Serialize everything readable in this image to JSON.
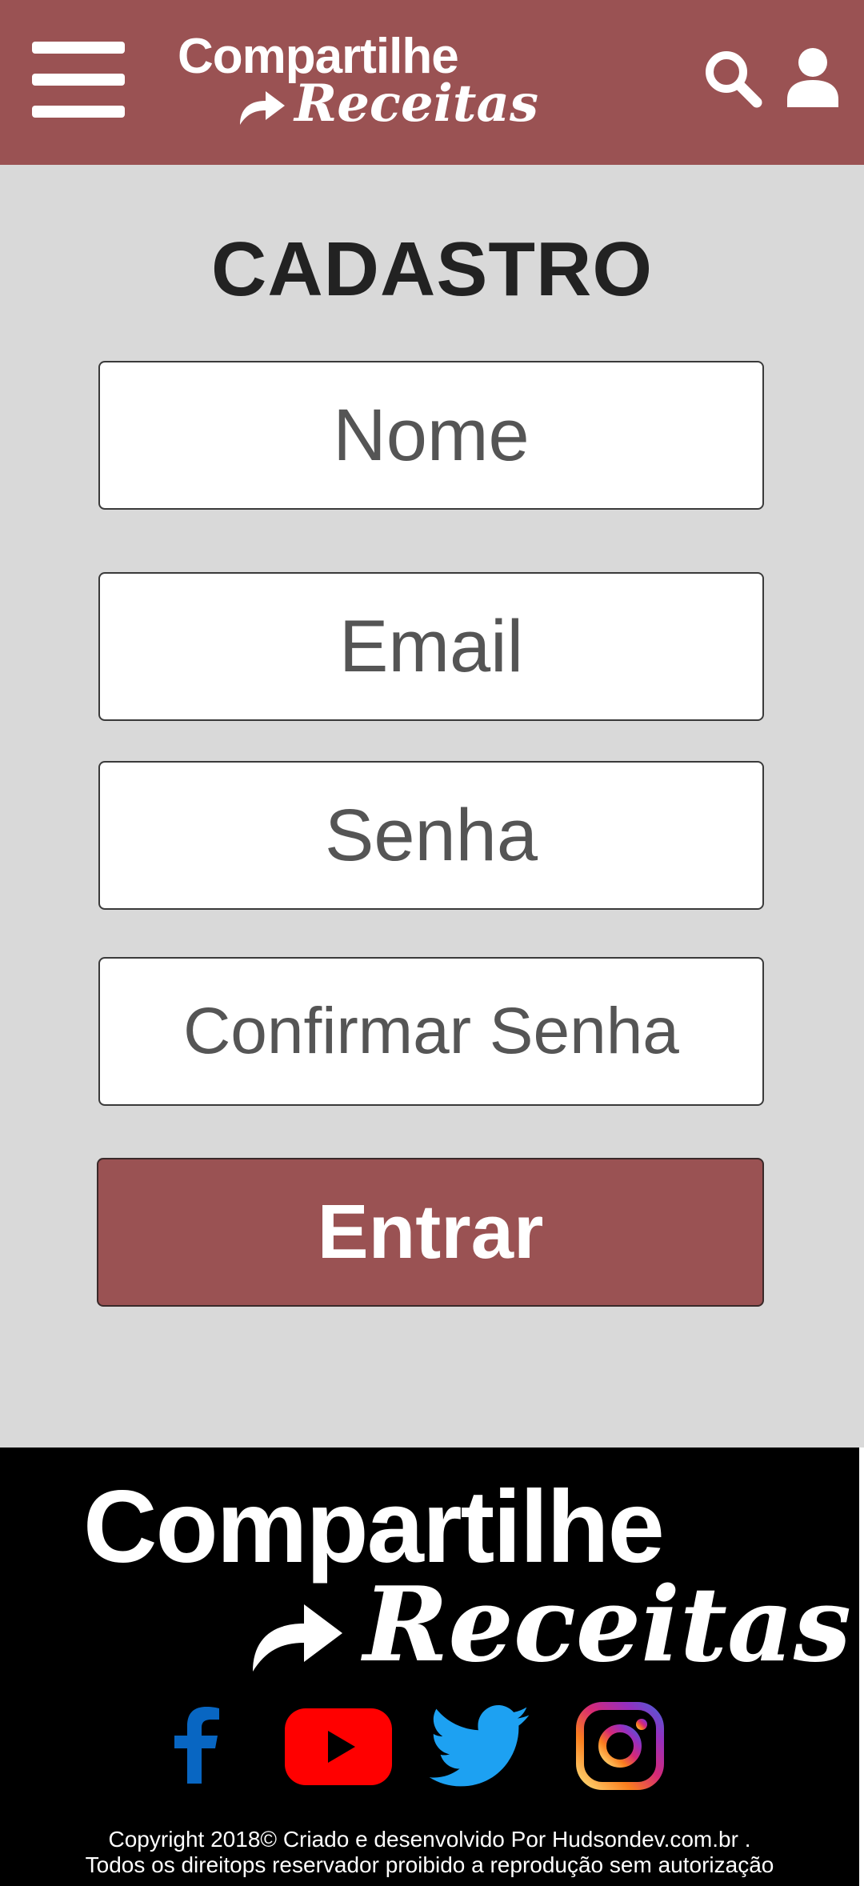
{
  "colors": {
    "brand": "#9a5253",
    "page_background": "#d9d9d9",
    "footer_background": "#000000",
    "facebook": "#0866c2",
    "youtube": "#ff0000",
    "twitter": "#1da1f2"
  },
  "header": {
    "menu_icon": "hamburger-menu-icon",
    "logo": {
      "line1": "Compartilhe",
      "line2": "Receitas",
      "arrow_icon": "share-arrow-icon"
    },
    "search_icon": "search-icon",
    "user_icon": "user-icon"
  },
  "main": {
    "title": "CADASTRO",
    "fields": {
      "nome_placeholder": "Nome",
      "email_placeholder": "Email",
      "senha_placeholder": "Senha",
      "confirmar_senha_placeholder": "Confirmar Senha"
    },
    "submit_label": "Entrar"
  },
  "footer": {
    "logo": {
      "line1": "Compartilhe",
      "line2": "Receitas",
      "arrow_icon": "share-arrow-icon"
    },
    "social": [
      "facebook-icon",
      "youtube-icon",
      "twitter-icon",
      "instagram-icon"
    ],
    "copyright_line1": "Copyright 2018© Criado e desenvolvido Por Hudsondev.com.br  .",
    "copyright_line2": "Todos os direitops reservador proibido a reprodução sem autorização"
  }
}
